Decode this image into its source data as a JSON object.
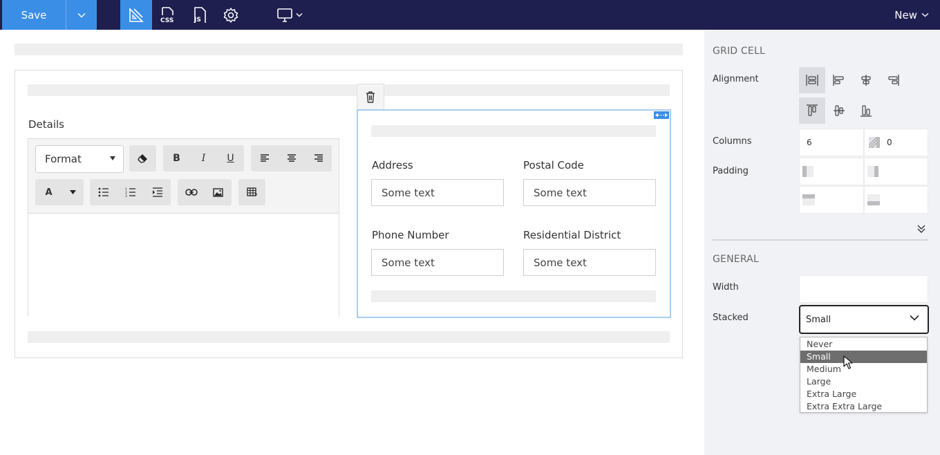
{
  "topbar": {
    "save_label": "Save",
    "new_label": "New",
    "icons": [
      "save-options-chevron-icon",
      "layout-ruler-icon",
      "css-file-icon",
      "js-file-icon",
      "gear-icon",
      "desktop-monitor-icon",
      "chevron-down-icon"
    ]
  },
  "canvas": {
    "details_label": "Details",
    "editor": {
      "format_label": "Format",
      "buttons": [
        "clear-format",
        "bold",
        "italic",
        "underline",
        "align-left",
        "align-center",
        "align-right",
        "font-color",
        "bulleted-list",
        "numbered-list",
        "indent",
        "link",
        "image",
        "table"
      ],
      "bold_glyph": "B",
      "italic_glyph": "I",
      "underline_glyph": "U",
      "font_color_glyph": "A"
    },
    "fields": [
      {
        "label": "Address",
        "placeholder": "Some text"
      },
      {
        "label": "Postal Code",
        "placeholder": "Some text"
      },
      {
        "label": "Phone Number",
        "placeholder": "Some text"
      },
      {
        "label": "Residential District",
        "placeholder": "Some text"
      }
    ]
  },
  "panel": {
    "grid_cell_heading": "GRID CELL",
    "alignment_label": "Alignment",
    "columns_label": "Columns",
    "columns_value": "6",
    "offset_value": "0",
    "padding_label": "Padding",
    "general_heading": "GENERAL",
    "width_label": "Width",
    "width_value": "",
    "stacked_label": "Stacked",
    "stacked_value": "Small",
    "stacked_options": [
      "Never",
      "Small",
      "Medium",
      "Large",
      "Extra Large",
      "Extra Extra Large"
    ]
  },
  "colors": {
    "topbar_bg": "#1e1e4f",
    "accent": "#3a8ee6",
    "panel_bg": "#f1f2f5",
    "selected_option_bg": "#6e6e6e"
  }
}
